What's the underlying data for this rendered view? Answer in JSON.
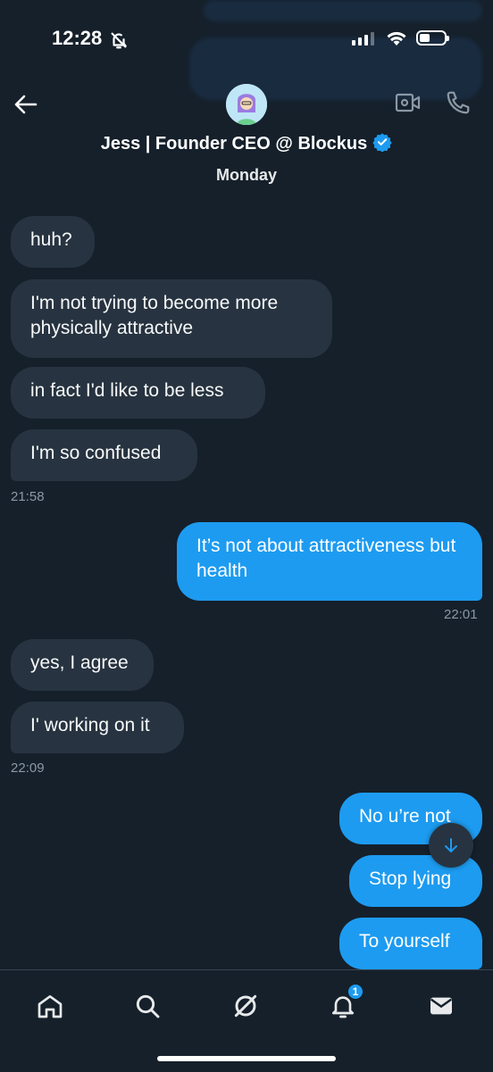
{
  "status_bar": {
    "time": "12:28"
  },
  "header": {
    "contact_name": "Jess | Founder CEO @ Blockus",
    "day": "Monday"
  },
  "messages": [
    {
      "text": "huh?"
    },
    {
      "text": "I'm not trying to become more physically attractive"
    },
    {
      "text": "in fact I'd like to be less"
    },
    {
      "text": "I'm so confused"
    },
    {
      "text": "It’s not about attractiveness but health"
    },
    {
      "text": "yes, I agree"
    },
    {
      "text": "I' working on it"
    },
    {
      "text": "No u’re not"
    },
    {
      "text": "Stop lying"
    },
    {
      "text": "To yourself"
    }
  ],
  "timestamps": [
    "21:58",
    "22:01",
    "22:09"
  ],
  "nav": {
    "items": [
      "home-icon",
      "search-icon",
      "grok-icon",
      "notifications-icon",
      "messages-icon"
    ],
    "notifications_badge": "1"
  },
  "colors": {
    "background": "#15202b",
    "incoming_bubble": "#273340",
    "outgoing_bubble": "#1d9bf0",
    "verified": "#1d9bf0"
  }
}
